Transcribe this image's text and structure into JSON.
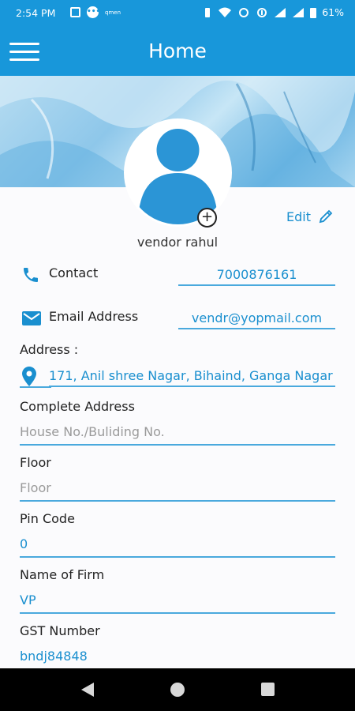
{
  "status_bar": {
    "time": "2:54 PM",
    "battery": "61%",
    "small_text": "qmen"
  },
  "app_bar": {
    "title": "Home"
  },
  "profile": {
    "name": "vendor rahul",
    "edit_label": "Edit"
  },
  "contact": {
    "label": "Contact",
    "value": "7000876161"
  },
  "email": {
    "label": "Email Address",
    "value": "vendr@yopmail.com"
  },
  "address": {
    "label": "Address :",
    "value": "171, Anil shree Nagar, Bihaind, Ganga Nagar"
  },
  "fields": [
    {
      "label": "Complete Address",
      "value": "House No./Buliding No.",
      "is_placeholder": true
    },
    {
      "label": "Floor",
      "value": "Floor",
      "is_placeholder": true
    },
    {
      "label": "Pin Code",
      "value": "0",
      "is_placeholder": false
    },
    {
      "label": "Name of Firm",
      "value": "VP",
      "is_placeholder": false
    },
    {
      "label": "GST Number",
      "value": "bndj84848",
      "is_placeholder": false
    }
  ],
  "colors": {
    "primary": "#1897da",
    "accent_text": "#1a8fcf",
    "underline": "#4aa9dd"
  }
}
